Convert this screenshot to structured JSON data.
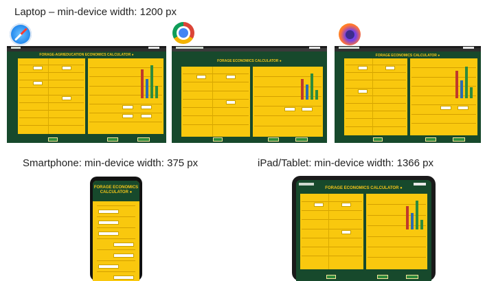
{
  "captions": {
    "laptop": "Laptop – min-device width: 1200 px",
    "smartphone": "Smartphone: min-device width: 375 px",
    "tablet": "iPad/Tablet: min-device width: 1366 px"
  },
  "browsers": [
    {
      "name": "Safari",
      "icon": "safari-icon"
    },
    {
      "name": "Chrome",
      "icon": "chrome-icon"
    },
    {
      "name": "Firefox",
      "icon": "firefox-icon"
    }
  ],
  "app": {
    "title_safari": "FORAGE-AGRIEDUCATION ECONOMICS CALCULATOR ●",
    "title_chrome": "FORAGE ECONOMICS CALCULATOR ●",
    "title_firefox": "FORAGE ECONOMICS CALCULATOR ●",
    "title_phone": "FORAGE ECONOMICS CALCULATOR ●",
    "title_tablet": "FORAGE ECONOMICS CALCULATOR ●"
  },
  "colors": {
    "app_background": "#17492c",
    "panel": "#f9c80e",
    "title": "#f5c518",
    "button": "#2e8b3c",
    "bar_red": "#c0392b",
    "bar_green": "#2e8b3c",
    "bar_blue": "#2b6cb0"
  }
}
